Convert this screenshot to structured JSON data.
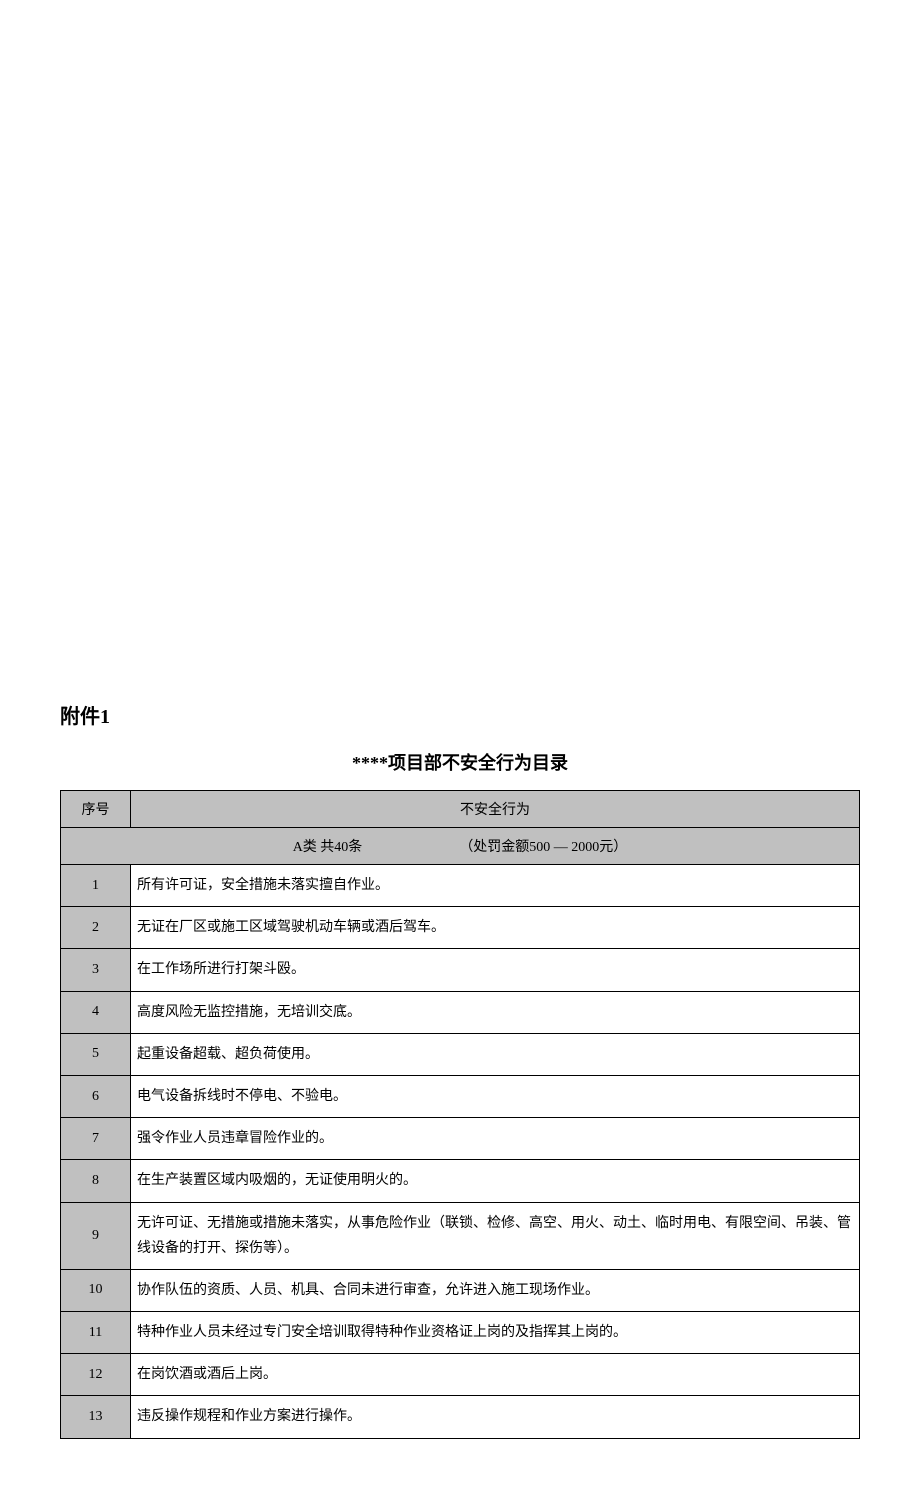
{
  "attachment_label": "附件1",
  "title": "****项目部不安全行为目录",
  "headers": {
    "seq": "序号",
    "desc": "不安全行为"
  },
  "category": {
    "left": "A类  共40条",
    "right": "（处罚金额500 — 2000元）"
  },
  "rows": [
    {
      "seq": "1",
      "desc": "所有许可证，安全措施未落实擅自作业。"
    },
    {
      "seq": "2",
      "desc": "无证在厂区或施工区域驾驶机动车辆或酒后驾车。"
    },
    {
      "seq": "3",
      "desc": "在工作场所进行打架斗殴。"
    },
    {
      "seq": "4",
      "desc": "高度风险无监控措施，无培训交底。"
    },
    {
      "seq": "5",
      "desc": "起重设备超载、超负荷使用。"
    },
    {
      "seq": "6",
      "desc": "电气设备拆线时不停电、不验电。"
    },
    {
      "seq": "7",
      "desc": "强令作业人员违章冒险作业的。"
    },
    {
      "seq": "8",
      "desc": "在生产装置区域内吸烟的，无证使用明火的。"
    },
    {
      "seq": "9",
      "desc": "无许可证、无措施或措施未落实，从事危险作业（联锁、检修、高空、用火、动土、临时用电、有限空间、吊装、管线设备的打开、探伤等）。"
    },
    {
      "seq": "10",
      "desc": "协作队伍的资质、人员、机具、合同未进行审查，允许进入施工现场作业。"
    },
    {
      "seq": "11",
      "desc": "特种作业人员未经过专门安全培训取得特种作业资格证上岗的及指挥其上岗的。"
    },
    {
      "seq": "12",
      "desc": "在岗饮酒或酒后上岗。"
    },
    {
      "seq": "13",
      "desc": "违反操作规程和作业方案进行操作。"
    }
  ]
}
